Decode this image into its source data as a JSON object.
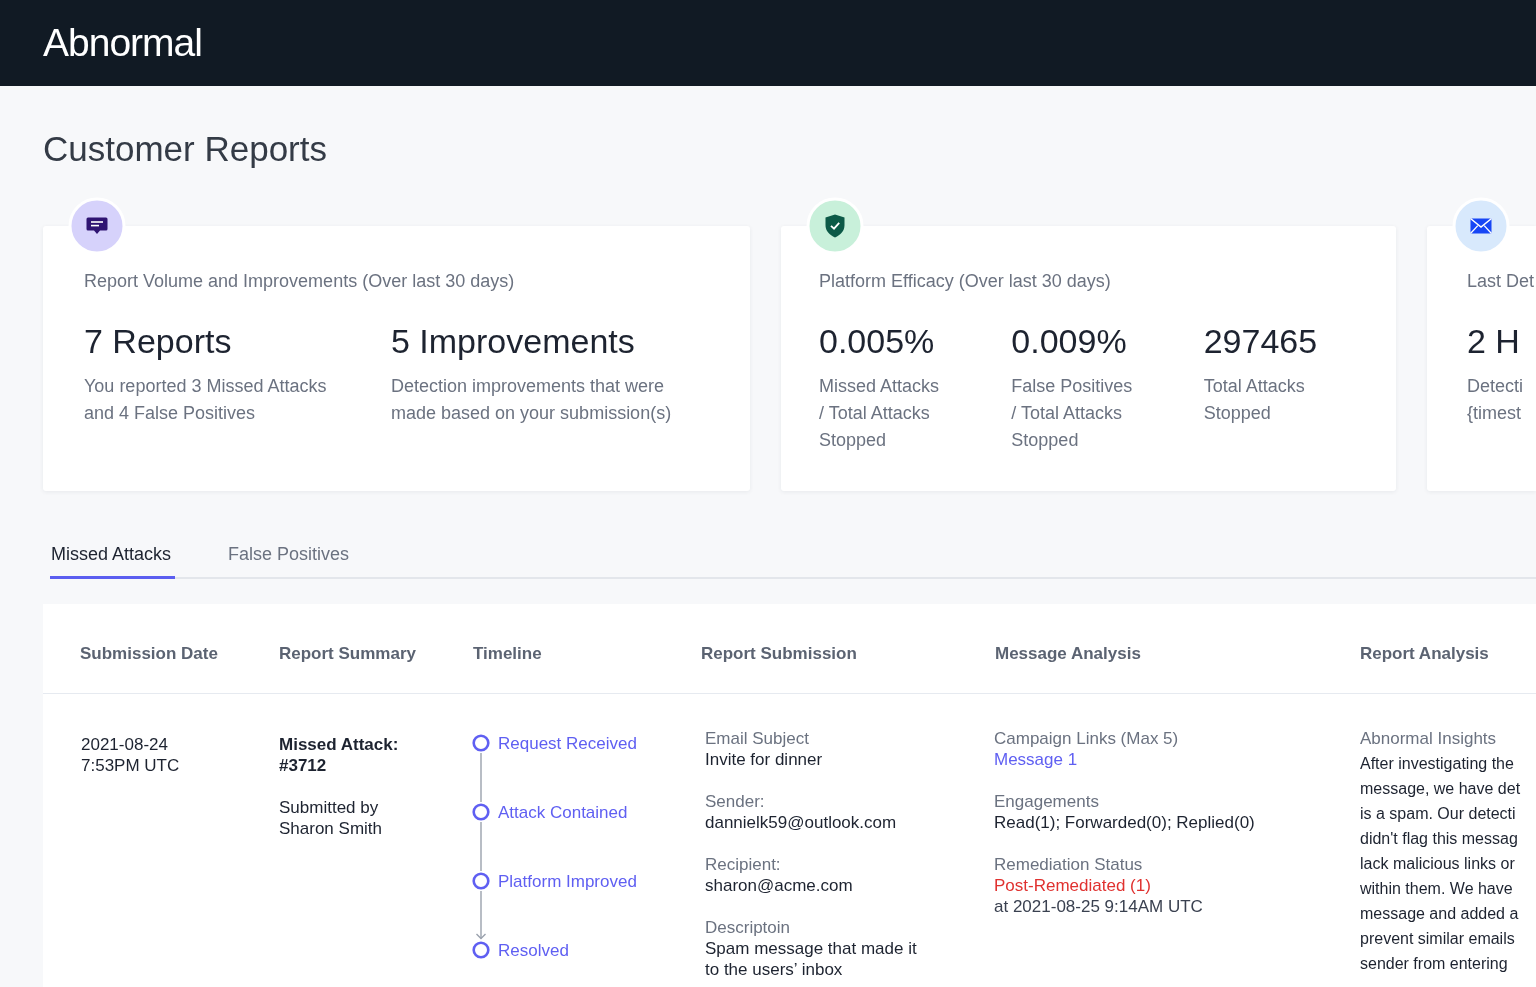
{
  "header": {
    "logo": "Abnormal"
  },
  "page_title": "Customer Reports",
  "cards": [
    {
      "title": "Report Volume and Improvements (Over last 30 days)",
      "stats": [
        {
          "value": "7 Reports",
          "description": "You reported 3 Missed Attacks and 4 False Positives"
        },
        {
          "value": "5 Improvements",
          "description": "Detection improvements that were made based on your submission(s)"
        }
      ]
    },
    {
      "title": "Platform Efficacy (Over last 30 days)",
      "stats": [
        {
          "value": "0.005%",
          "description": "Missed Attacks / Total Attacks Stopped"
        },
        {
          "value": "0.009%",
          "description": "False Positives / Total Attacks Stopped"
        },
        {
          "value": "297465",
          "description": "Total Attacks Stopped"
        }
      ]
    },
    {
      "title": "Last Det",
      "stats": [
        {
          "value": "2 H",
          "description": "Detecti {timest"
        }
      ]
    }
  ],
  "tabs": [
    {
      "label": "Missed Attacks",
      "selected": true
    },
    {
      "label": "False Positives",
      "selected": false
    }
  ],
  "table": {
    "columns": [
      "Submission Date",
      "Report Summary",
      "Timeline",
      "Report Submission",
      "Message Analysis",
      "Report Analysis"
    ],
    "rows": [
      {
        "submission_date": "2021-08-24 7:53PM UTC",
        "summary": {
          "title": "Missed Attack: #3712",
          "submitted_by": "Submitted by Sharon Smith"
        },
        "timeline": [
          {
            "label": "Request Received"
          },
          {
            "label": "Attack Contained"
          },
          {
            "label": "Platform Improved"
          },
          {
            "label": "Resolved"
          }
        ],
        "report_submission": [
          {
            "label": "Email Subject",
            "value": "Invite for dinner"
          },
          {
            "label": "Sender:",
            "value": "dannielk59@outlook.com"
          },
          {
            "label": "Recipient:",
            "value": "sharon@acme.com"
          },
          {
            "label": "Descriptoin",
            "value": "Spam message that made it to the users’ inbox"
          }
        ],
        "message_analysis": [
          {
            "label": "Campaign Links (Max 5)",
            "kind": "link",
            "value": "Message 1"
          },
          {
            "label": "Engagements",
            "kind": "text",
            "value": "Read(1); Forwarded(0); Replied(0)"
          },
          {
            "label": "Remediation Status",
            "kind": "status",
            "value": "Post-Remediated (1)",
            "detail": "at 2021-08-25 9:14AM UTC"
          }
        ],
        "report_analysis": {
          "label": "Abnormal Insights",
          "lines": [
            "After investigating the",
            "message, we have det",
            "is a spam. Our detecti",
            "didn't flag this messag",
            "lack malicious links or",
            "within them. We have",
            "message and added a",
            "prevent similar emails",
            "sender from entering"
          ]
        }
      }
    ]
  }
}
